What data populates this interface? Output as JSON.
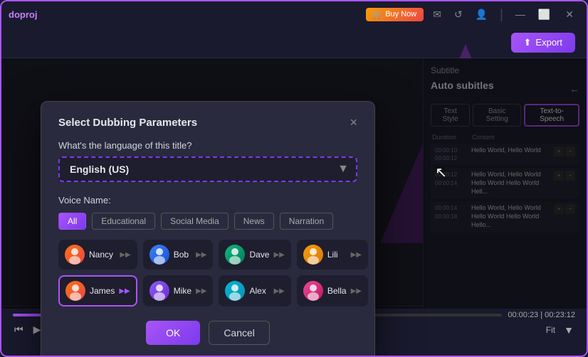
{
  "app": {
    "name": "doproj",
    "title_bar": {
      "buy_now": "Buy Now",
      "export_label": "Export"
    }
  },
  "dialog": {
    "title": "Select Dubbing Parameters",
    "close_label": "×",
    "language_question": "What's the language of this title?",
    "language_value": "English (US)",
    "voice_label": "Voice Name:",
    "ok_label": "OK",
    "cancel_label": "Cancel"
  },
  "filter_tabs": [
    {
      "label": "All",
      "active": true
    },
    {
      "label": "Educational",
      "active": false
    },
    {
      "label": "Social Media",
      "active": false
    },
    {
      "label": "News",
      "active": false
    },
    {
      "label": "Narration",
      "active": false
    }
  ],
  "voices": [
    {
      "name": "Nancy",
      "avatar_class": "av-nancy",
      "avatar_emoji": "👩",
      "selected": false
    },
    {
      "name": "Bob",
      "avatar_class": "av-bob",
      "avatar_emoji": "👨",
      "selected": false
    },
    {
      "name": "Dave",
      "avatar_class": "av-dave",
      "avatar_emoji": "🧔",
      "selected": false
    },
    {
      "name": "Lili",
      "avatar_class": "av-lili",
      "avatar_emoji": "👩",
      "selected": false
    },
    {
      "name": "James",
      "avatar_class": "av-james",
      "avatar_emoji": "👨",
      "selected": true
    },
    {
      "name": "Mike",
      "avatar_class": "av-mike",
      "avatar_emoji": "🧑",
      "selected": false
    },
    {
      "name": "Alex",
      "avatar_class": "av-alex",
      "avatar_emoji": "🧑",
      "selected": false
    },
    {
      "name": "Bella",
      "avatar_class": "av-bella",
      "avatar_emoji": "👩",
      "selected": false
    }
  ],
  "subtitle_panel": {
    "subtitle_label": "Subtitle",
    "auto_subtitles_label": "Auto subitles",
    "tabs": [
      {
        "label": "Text Style",
        "active": false
      },
      {
        "label": "Basic Setting",
        "active": false
      },
      {
        "label": "Text-to-Speech",
        "active": true
      }
    ],
    "table_headers": [
      "Duration",
      "Content"
    ],
    "rows": [
      {
        "time": "00:00:10\n00:00:12",
        "content": "Hello World, Hello World"
      },
      {
        "time": "00:00:12\n00:00:14",
        "content": "Hello World, Hello World\nHello World Hello World Hell..."
      },
      {
        "time": "00:00:14\n00:00:18",
        "content": "Hello World, Hello World\nHello World Hello World Hello..."
      }
    ]
  },
  "player": {
    "current_time": "00:00:23",
    "total_time": "00:23:12"
  }
}
